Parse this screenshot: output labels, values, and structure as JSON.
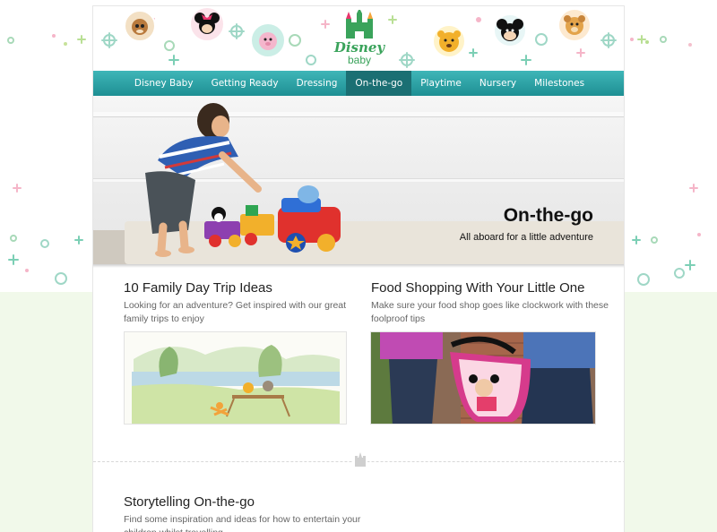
{
  "brand": {
    "name": "Disney",
    "sub": "baby"
  },
  "nav": [
    {
      "label": "Disney Baby",
      "active": false
    },
    {
      "label": "Getting Ready",
      "active": false
    },
    {
      "label": "Dressing",
      "active": false
    },
    {
      "label": "On-the-go",
      "active": true
    },
    {
      "label": "Playtime",
      "active": false
    },
    {
      "label": "Nursery",
      "active": false
    },
    {
      "label": "Milestones",
      "active": false
    }
  ],
  "hero": {
    "title": "On-the-go",
    "subtitle": "All aboard for a little adventure"
  },
  "articles": [
    {
      "title": "10 Family Day Trip Ideas",
      "desc": "Looking for an adventure? Get inspired with our great family trips to enjoy"
    },
    {
      "title": "Food Shopping With Your Little One",
      "desc": "Make sure your food shop goes like clockwork with these foolproof tips"
    },
    {
      "title": "Storytelling On-the-go",
      "desc": "Find some inspiration and ideas for how to entertain your children whilst travelling"
    }
  ],
  "icons": {
    "characters": [
      "bambi-icon",
      "minnie-icon",
      "piglet-icon",
      "pooh-icon",
      "mickey-icon",
      "simba-icon"
    ],
    "castle": "castle-icon"
  },
  "colors": {
    "nav_top": "#3fb6b8",
    "nav_bottom": "#1e8f93",
    "nav_active": "#1b6f73",
    "brand_green": "#3aa35b",
    "bg_green": "#f1f9ea"
  }
}
